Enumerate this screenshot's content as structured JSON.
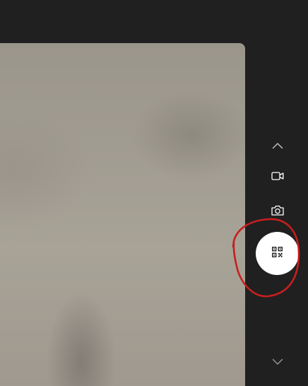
{
  "camera": {
    "controls": [
      {
        "id": "scroll-up",
        "icon": "chevron-up-icon"
      },
      {
        "id": "video-mode",
        "icon": "video-camera-icon"
      },
      {
        "id": "photo-mode",
        "icon": "camera-icon"
      },
      {
        "id": "qr-scan-mode",
        "icon": "qr-code-icon",
        "selected": true
      },
      {
        "id": "scroll-down",
        "icon": "chevron-down-icon"
      }
    ]
  },
  "annotation": {
    "type": "hand-drawn-circle",
    "color": "#cc1f1f",
    "target": "qr-scan-mode"
  },
  "colors": {
    "background": "#202020",
    "icon": "#ffffff",
    "chevron": "#a8a8a8",
    "active_button": "#ffffff"
  }
}
